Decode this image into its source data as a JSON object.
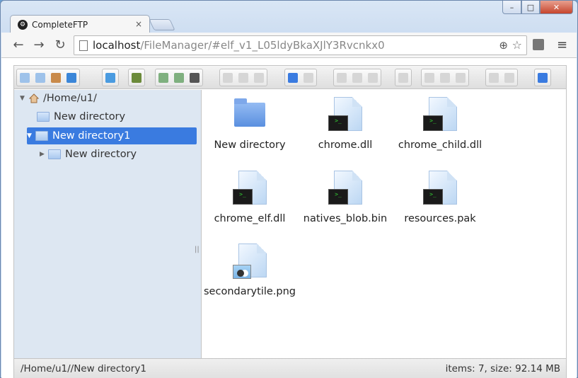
{
  "window": {
    "minimize_glyph": "–",
    "maximize_glyph": "□",
    "close_glyph": "✕"
  },
  "tab": {
    "title": "CompleteFTP",
    "close_glyph": "×"
  },
  "nav": {
    "back": "←",
    "forward": "→",
    "reload": "↻"
  },
  "omnibox": {
    "host": "localhost",
    "path": "/FileManager/#elf_v1_L05ldyBkaXJlY3Rvcnkx0"
  },
  "toolbar_icons": {
    "menu": "≡",
    "zoom": "⊕",
    "star": "☆"
  },
  "tree": {
    "root": "/Home/u1/",
    "items": [
      {
        "label": "New directory"
      },
      {
        "label": "New directory1"
      },
      {
        "label": "New directory"
      }
    ],
    "splitter": "||"
  },
  "files": [
    {
      "name": "New directory",
      "kind": "folder"
    },
    {
      "name": "chrome.dll",
      "kind": "binary"
    },
    {
      "name": "chrome_child.dll",
      "kind": "binary"
    },
    {
      "name": "chrome_elf.dll",
      "kind": "binary"
    },
    {
      "name": "natives_blob.bin",
      "kind": "binary"
    },
    {
      "name": "resources.pak",
      "kind": "binary"
    },
    {
      "name": "secondarytile.png",
      "kind": "image"
    }
  ],
  "terminal_glyph": ">_",
  "status": {
    "path": "/Home/u1//New directory1",
    "summary": "items: 7, size: 92.14 MB"
  },
  "colors": {
    "selection": "#3a7be0",
    "tree_bg": "#dde7f2",
    "folder": "#5a8fdf"
  }
}
